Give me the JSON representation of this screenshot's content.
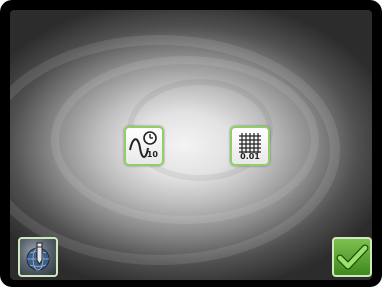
{
  "screen": {
    "measure_button": {
      "icon": "waveform-timer-icon",
      "label": "10"
    },
    "grid_button": {
      "icon": "grid-icon",
      "label": "0.01"
    },
    "settings_button": {
      "icon": "globe-pen-icon"
    },
    "confirm_button": {
      "icon": "checkmark-icon"
    }
  },
  "colors": {
    "frame": "#000000",
    "tile_border": "#8fcf6a",
    "confirm_green": "#5fb33a"
  }
}
